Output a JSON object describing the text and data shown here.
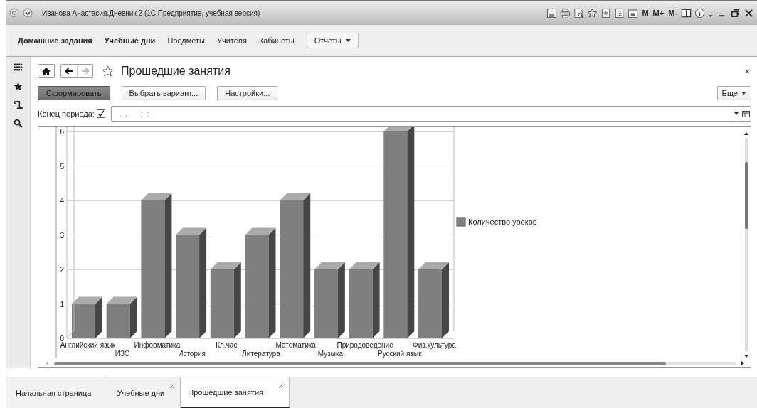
{
  "window": {
    "title": "Иванова Анастасия.Дневник 2  (1С:Предприятие, учебная версия)",
    "memory_buttons": [
      "M",
      "M+",
      "M-"
    ]
  },
  "sections": [
    {
      "label": "Домашние задания",
      "bold": true,
      "kind": "link"
    },
    {
      "label": "Учебные дни",
      "bold": true,
      "kind": "link"
    },
    {
      "label": "Предметы",
      "bold": false,
      "kind": "link"
    },
    {
      "label": "Учителя",
      "bold": false,
      "kind": "link"
    },
    {
      "label": "Кабинеты",
      "bold": false,
      "kind": "link"
    },
    {
      "label": "Отчеты",
      "bold": false,
      "kind": "menu"
    }
  ],
  "form": {
    "title": "Прошедшие занятия",
    "favorite": false,
    "buttons": [
      {
        "label": "Сформировать",
        "default": true
      },
      {
        "label": "Выбрать вариант...",
        "default": false
      },
      {
        "label": "Настройки...",
        "default": false
      }
    ],
    "more_button": "Еще",
    "period": {
      "label": "Конец периода:",
      "checked": true,
      "value": " .  .       :  :"
    },
    "chart_data": {
      "type": "bar",
      "categories": [
        "Английский язык",
        "ИЗО",
        "Информатика",
        "История",
        "Кл.час",
        "Литература",
        "Математика",
        "Музыка",
        "Природоведение",
        "Русский язык",
        "Физ.культура"
      ],
      "series": [
        {
          "name": "Количество уроков",
          "color": "#7f7f7f",
          "values": [
            1,
            1,
            4,
            3,
            2,
            3,
            4,
            2,
            2,
            6,
            2
          ]
        }
      ],
      "yticks": [
        0,
        1,
        2,
        3,
        4,
        5,
        6
      ],
      "ylim": [
        0,
        6
      ],
      "grid": true
    }
  },
  "open_tabs": [
    {
      "label": "Начальная страница",
      "selected": false,
      "closable": false
    },
    {
      "label": "Учебные дни",
      "selected": false,
      "closable": true
    },
    {
      "label": "Прошедшие занятия",
      "selected": true,
      "closable": true
    }
  ]
}
